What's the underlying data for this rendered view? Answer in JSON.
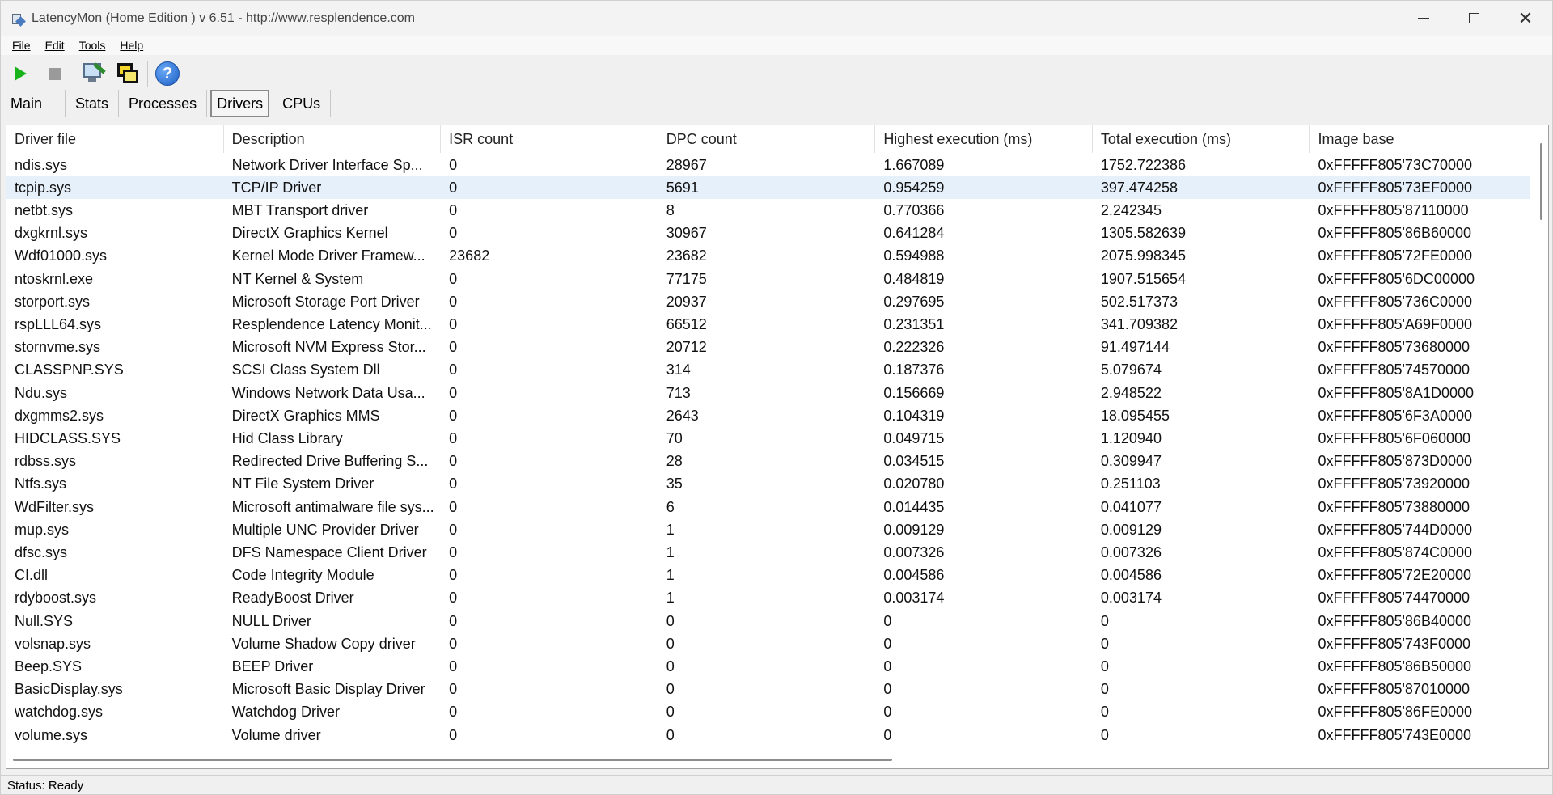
{
  "window": {
    "title": "LatencyMon  (Home Edition )  v 6.51 - http://www.resplendence.com",
    "controls": {
      "minimize": "",
      "maximize": "",
      "close": "✕"
    }
  },
  "menu": {
    "items": [
      {
        "label": "File"
      },
      {
        "label": "Edit"
      },
      {
        "label": "Tools"
      },
      {
        "label": "Help"
      }
    ]
  },
  "toolbar": {
    "buttons": [
      "play-icon",
      "stop-icon",
      "monitor-icon",
      "windows-icon",
      "help-icon"
    ],
    "help_glyph": "?"
  },
  "tabs": [
    {
      "label": "Main",
      "active": false
    },
    {
      "label": "Stats",
      "active": false
    },
    {
      "label": "Processes",
      "active": false
    },
    {
      "label": "Drivers",
      "active": true
    },
    {
      "label": "CPUs",
      "active": false
    }
  ],
  "table": {
    "columns": [
      "Driver file",
      "Description",
      "ISR count",
      "DPC count",
      "Highest execution (ms)",
      "Total execution (ms)",
      "Image base"
    ],
    "selected_row": 1,
    "rows": [
      [
        "ndis.sys",
        "Network Driver Interface Sp...",
        "0",
        "28967",
        "1.667089",
        "1752.722386",
        "0xFFFFF805'73C70000"
      ],
      [
        "tcpip.sys",
        "TCP/IP Driver",
        "0",
        "5691",
        "0.954259",
        "397.474258",
        "0xFFFFF805'73EF0000"
      ],
      [
        "netbt.sys",
        "MBT Transport driver",
        "0",
        "8",
        "0.770366",
        "2.242345",
        "0xFFFFF805'87110000"
      ],
      [
        "dxgkrnl.sys",
        "DirectX Graphics Kernel",
        "0",
        "30967",
        "0.641284",
        "1305.582639",
        "0xFFFFF805'86B60000"
      ],
      [
        "Wdf01000.sys",
        "Kernel Mode Driver Framew...",
        "23682",
        "23682",
        "0.594988",
        "2075.998345",
        "0xFFFFF805'72FE0000"
      ],
      [
        "ntoskrnl.exe",
        "NT Kernel & System",
        "0",
        "77175",
        "0.484819",
        "1907.515654",
        "0xFFFFF805'6DC00000"
      ],
      [
        "storport.sys",
        "Microsoft Storage Port Driver",
        "0",
        "20937",
        "0.297695",
        "502.517373",
        "0xFFFFF805'736C0000"
      ],
      [
        "rspLLL64.sys",
        "Resplendence Latency Monit...",
        "0",
        "66512",
        "0.231351",
        "341.709382",
        "0xFFFFF805'A69F0000"
      ],
      [
        "stornvme.sys",
        "Microsoft NVM Express Stor...",
        "0",
        "20712",
        "0.222326",
        "91.497144",
        "0xFFFFF805'73680000"
      ],
      [
        "CLASSPNP.SYS",
        "SCSI Class System Dll",
        "0",
        "314",
        "0.187376",
        "5.079674",
        "0xFFFFF805'74570000"
      ],
      [
        "Ndu.sys",
        "Windows Network Data Usa...",
        "0",
        "713",
        "0.156669",
        "2.948522",
        "0xFFFFF805'8A1D0000"
      ],
      [
        "dxgmms2.sys",
        "DirectX Graphics MMS",
        "0",
        "2643",
        "0.104319",
        "18.095455",
        "0xFFFFF805'6F3A0000"
      ],
      [
        "HIDCLASS.SYS",
        "Hid Class Library",
        "0",
        "70",
        "0.049715",
        "1.120940",
        "0xFFFFF805'6F060000"
      ],
      [
        "rdbss.sys",
        "Redirected Drive Buffering S...",
        "0",
        "28",
        "0.034515",
        "0.309947",
        "0xFFFFF805'873D0000"
      ],
      [
        "Ntfs.sys",
        "NT File System Driver",
        "0",
        "35",
        "0.020780",
        "0.251103",
        "0xFFFFF805'73920000"
      ],
      [
        "WdFilter.sys",
        "Microsoft antimalware file sys...",
        "0",
        "6",
        "0.014435",
        "0.041077",
        "0xFFFFF805'73880000"
      ],
      [
        "mup.sys",
        "Multiple UNC Provider Driver",
        "0",
        "1",
        "0.009129",
        "0.009129",
        "0xFFFFF805'744D0000"
      ],
      [
        "dfsc.sys",
        "DFS Namespace Client Driver",
        "0",
        "1",
        "0.007326",
        "0.007326",
        "0xFFFFF805'874C0000"
      ],
      [
        "CI.dll",
        "Code Integrity Module",
        "0",
        "1",
        "0.004586",
        "0.004586",
        "0xFFFFF805'72E20000"
      ],
      [
        "rdyboost.sys",
        "ReadyBoost Driver",
        "0",
        "1",
        "0.003174",
        "0.003174",
        "0xFFFFF805'74470000"
      ],
      [
        "Null.SYS",
        "NULL Driver",
        "0",
        "0",
        "0",
        "0",
        "0xFFFFF805'86B40000"
      ],
      [
        "volsnap.sys",
        "Volume Shadow Copy driver",
        "0",
        "0",
        "0",
        "0",
        "0xFFFFF805'743F0000"
      ],
      [
        "Beep.SYS",
        "BEEP Driver",
        "0",
        "0",
        "0",
        "0",
        "0xFFFFF805'86B50000"
      ],
      [
        "BasicDisplay.sys",
        "Microsoft Basic Display Driver",
        "0",
        "0",
        "0",
        "0",
        "0xFFFFF805'87010000"
      ],
      [
        "watchdog.sys",
        "Watchdog Driver",
        "0",
        "0",
        "0",
        "0",
        "0xFFFFF805'86FE0000"
      ],
      [
        "volume.sys",
        "Volume driver",
        "0",
        "0",
        "0",
        "0",
        "0xFFFFF805'743E0000"
      ]
    ]
  },
  "status": {
    "text": "Status: Ready"
  }
}
